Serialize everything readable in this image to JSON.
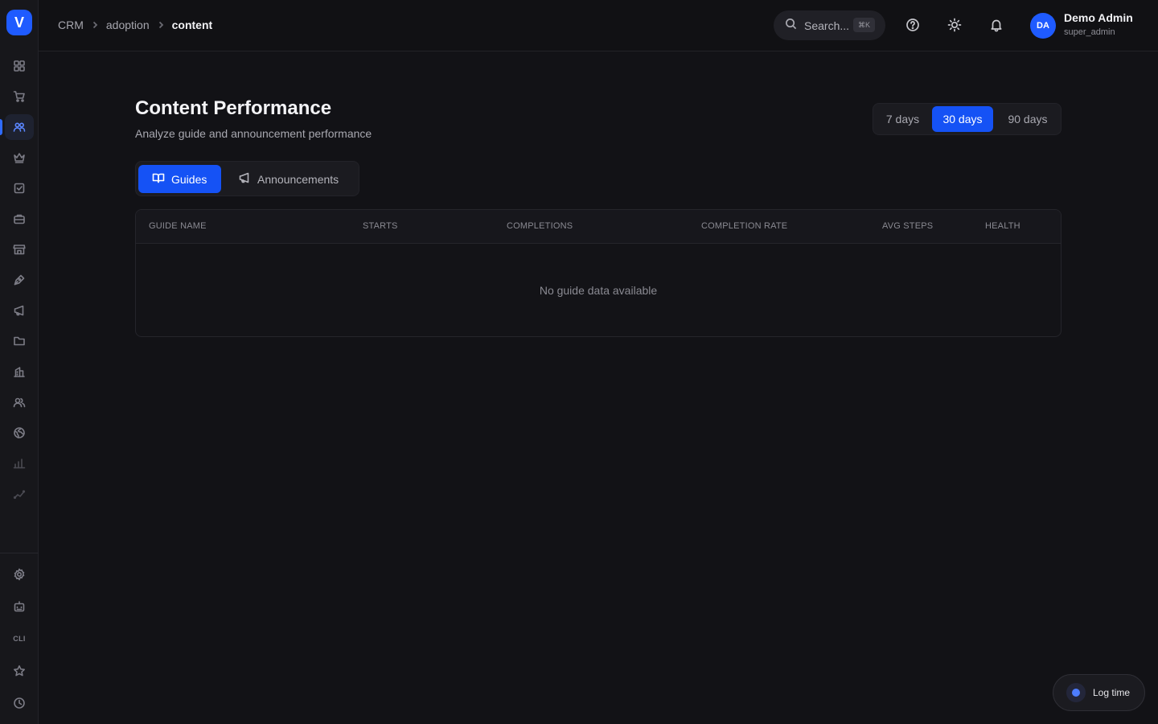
{
  "app": {
    "logo_letter": "V"
  },
  "sidebar": {
    "items": [
      {
        "icon": "grid-icon"
      },
      {
        "icon": "cart-icon"
      },
      {
        "icon": "users-icon",
        "active": true
      },
      {
        "icon": "crown-icon"
      },
      {
        "icon": "checkbox-icon"
      },
      {
        "icon": "briefcase-icon"
      },
      {
        "icon": "store-icon"
      },
      {
        "icon": "pen-icon"
      },
      {
        "icon": "megaphone-icon"
      },
      {
        "icon": "folder-icon"
      },
      {
        "icon": "building-icon"
      },
      {
        "icon": "team-icon"
      },
      {
        "icon": "globe-icon"
      },
      {
        "icon": "bar-chart-icon"
      },
      {
        "icon": "trend-icon"
      }
    ],
    "bottom": [
      {
        "icon": "gear-icon"
      },
      {
        "icon": "robot-icon"
      },
      {
        "icon": "cli-icon",
        "label": "CLI"
      },
      {
        "icon": "star-icon"
      },
      {
        "icon": "clock-icon"
      }
    ]
  },
  "topbar": {
    "breadcrumb": [
      "CRM",
      "adoption",
      "content"
    ],
    "search_placeholder": "Search...",
    "search_shortcut": "⌘K",
    "user": {
      "initials": "DA",
      "name": "Demo Admin",
      "role": "super_admin"
    }
  },
  "main": {
    "title": "Content Performance",
    "subtitle": "Analyze guide and announcement performance",
    "ranges": [
      "7 days",
      "30 days",
      "90 days"
    ],
    "active_range": "30 days",
    "tabs": [
      "Guides",
      "Announcements"
    ],
    "active_tab": "Guides",
    "table": {
      "columns": [
        "GUIDE NAME",
        "STARTS",
        "COMPLETIONS",
        "COMPLETION RATE",
        "AVG STEPS",
        "HEALTH"
      ],
      "empty_message": "No guide data available"
    }
  },
  "log_time": {
    "label": "Log time"
  },
  "colors": {
    "accent": "#1552f5",
    "background": "#121216",
    "sidebar": "#17171b"
  }
}
